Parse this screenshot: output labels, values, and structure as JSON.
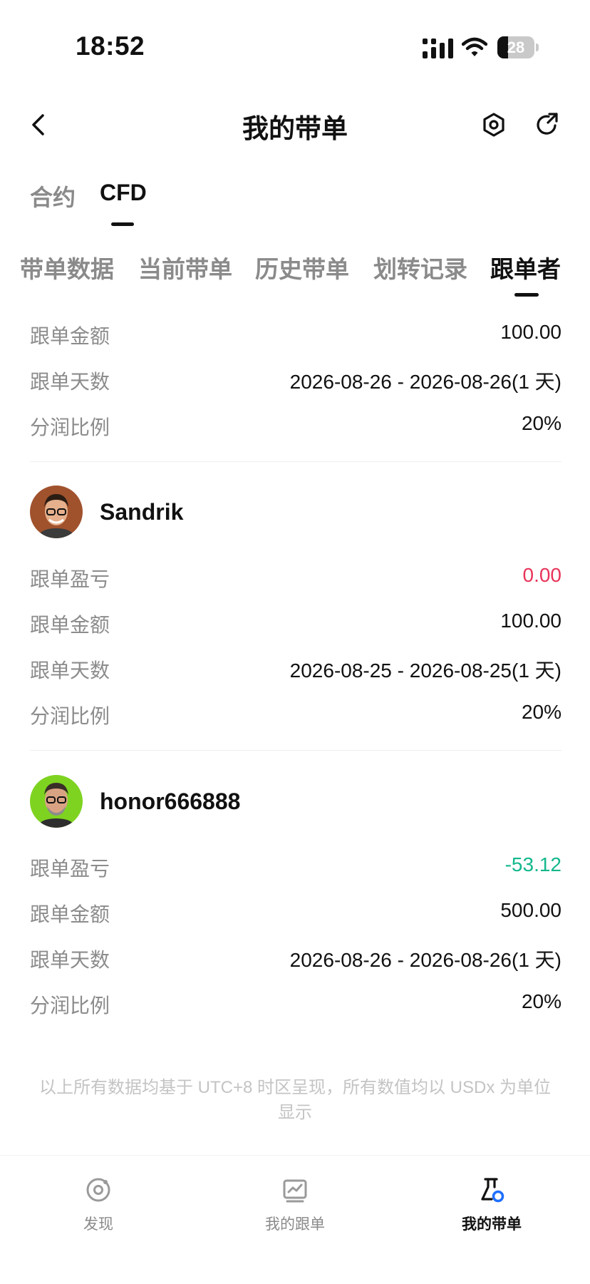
{
  "status_bar": {
    "time": "18:52",
    "battery": "28",
    "battery_level": 0.28
  },
  "header": {
    "title": "我的带单"
  },
  "product_tabs": [
    {
      "label": "合约",
      "active": false
    },
    {
      "label": "CFD",
      "active": true
    }
  ],
  "sub_tabs": [
    {
      "label": "带单数据",
      "active": false
    },
    {
      "label": "当前带单",
      "active": false
    },
    {
      "label": "历史带单",
      "active": false
    },
    {
      "label": "划转记录",
      "active": false
    },
    {
      "label": "跟单者",
      "active": true
    }
  ],
  "records": [
    {
      "rows": [
        {
          "label": "跟单金额",
          "value": "100.00"
        },
        {
          "label": "跟单天数",
          "value": "2026-08-26 - 2026-08-26(1 天)"
        },
        {
          "label": "分润比例",
          "value": "20%"
        }
      ]
    },
    {
      "username": "Sandrik",
      "avatar_bg": "#a0522d",
      "rows": [
        {
          "label": "跟单盈亏",
          "value": "0.00",
          "color": "#e8345a"
        },
        {
          "label": "跟单金额",
          "value": "100.00"
        },
        {
          "label": "跟单天数",
          "value": "2026-08-25 - 2026-08-25(1 天)"
        },
        {
          "label": "分润比例",
          "value": "20%"
        }
      ]
    },
    {
      "username": "honor666888",
      "avatar_bg": "#7ed321",
      "rows": [
        {
          "label": "跟单盈亏",
          "value": "-53.12",
          "color": "#14b88c"
        },
        {
          "label": "跟单金额",
          "value": "500.00"
        },
        {
          "label": "跟单天数",
          "value": "2026-08-26 - 2026-08-26(1 天)"
        },
        {
          "label": "分润比例",
          "value": "20%"
        }
      ]
    }
  ],
  "footnote": "以上所有数据均基于 UTC+8 时区呈现，所有数值均以 USDx 为单位显示",
  "bottom_nav": [
    {
      "label": "发现",
      "icon": "discover-icon",
      "active": false
    },
    {
      "label": "我的跟单",
      "icon": "chart-icon",
      "active": false
    },
    {
      "label": "我的带单",
      "icon": "flask-icon",
      "active": true
    }
  ],
  "colors": {
    "accent": "#1f6fff",
    "loss": "#e8345a",
    "gain": "#14b88c"
  }
}
